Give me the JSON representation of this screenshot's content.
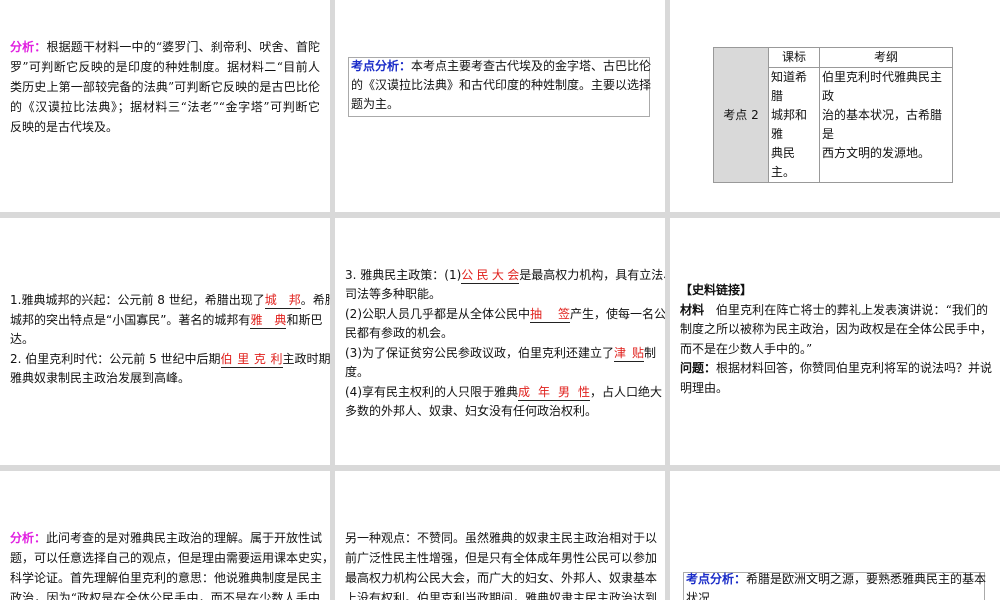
{
  "p1": {
    "label": "分析：",
    "lines": [
      "根据题干材料一中的“婆罗门、刹帝利、吠舍、首陀",
      "罗”可判断它反映的是印度的种姓制度。据材料二“目前人",
      "类历史上第一部较完备的法典”可判断它反映的是古巴比伦",
      "的《汉谟拉比法典》；据材料三“法老”“金字塔”可判断它",
      "反映的是古代埃及。"
    ]
  },
  "p2": {
    "label": "考点分析：",
    "lines": [
      "本考点主要考查古代埃及的金字塔、古巴比伦",
      "的《汉谟拉比法典》和古代印度的种姓制度。主要以选择",
      "题为主。"
    ]
  },
  "p3": {
    "row_head": "考点 2",
    "col1": "课标",
    "col2": "考纲",
    "cell1": [
      "知道希腊",
      "城邦和雅",
      "典民主。"
    ],
    "cell2": [
      "伯里克利时代雅典民主政",
      "治的基本状况，古希腊是",
      "西方文明的发源地。"
    ]
  },
  "p4": {
    "l1a": "1.雅典城邦的兴起：公元前 8 世纪，希腊出现了",
    "b1": "城邦",
    "l1b": "。希腊",
    "l2a": "城邦的突出特点是“小国寡民”。著名的城邦有",
    "b2": "雅典",
    "l2b": "和斯巴",
    "l3": "达。",
    "l4a": "2. 伯里克利时代：公元前 5 世纪中后期",
    "b3": "伯里克利",
    "l4b": "主政时期，",
    "l5": "雅典奴隶制民主政治发展到高峰。"
  },
  "p5": {
    "l1a": "3. 雅典民主政策：(1)",
    "b1": "公民大会",
    "l1b": "是最高权力机构，具有立法、",
    "l2": "司法等多种职能。",
    "l3a": "(2)公职人员几乎都是从全体公民中",
    "b2": "抽签",
    "l3b": "产生，使每一名公",
    "l4": "民都有参政的机会。",
    "l5a": "(3)为了保证贫穷公民参政议政，伯里克利还建立了",
    "b3": "津贴",
    "l5b": "制",
    "l6": "度。",
    "l7a": "(4)享有民主权利的人只限于雅典",
    "b4": "成年男性",
    "l7b": "，占人口绝大",
    "l8": "多数的外邦人、奴隶、妇女没有任何政治权利。"
  },
  "p6": {
    "heading": "【史料链接】",
    "material_label": "材料",
    "lines": [
      "伯里克利在阵亡将士的葬礼上发表演讲说：“我们的",
      "制度之所以被称为民主政治，因为政权是在全体公民手中，",
      "而不是在少数人手中的。”"
    ],
    "question_label": "问题：",
    "question_lines": [
      "根据材料回答，你赞同伯里克利将军的说法吗？并说",
      "明理由。"
    ]
  },
  "p7": {
    "label": "分析：",
    "lines": [
      "此问考查的是对雅典民主政治的理解。属于开放性试",
      "题，可以任意选择自己的观点，但是理由需要运用课本史实，",
      "科学论证。首先理解伯里克利的意思：他说雅典制度是民主",
      "政治，因为“政权是在全体公民手中，而不是在少数人手中"
    ]
  },
  "p8": {
    "lines": [
      "另一种观点：不赞同。虽然雅典的奴隶主民主政治相对于以",
      "前广泛性民主性增强，但是只有全体成年男性公民可以参加",
      "最高权力机构公民大会，而广大的妇女、外邦人、奴隶基本",
      "上没有权利。伯里克利当政期间，雅典奴隶主民主政治达到"
    ]
  },
  "p9": {
    "label": "考点分析：",
    "lines": [
      "希腊是欧洲文明之源，要熟悉雅典民主的基本",
      "状况"
    ]
  }
}
